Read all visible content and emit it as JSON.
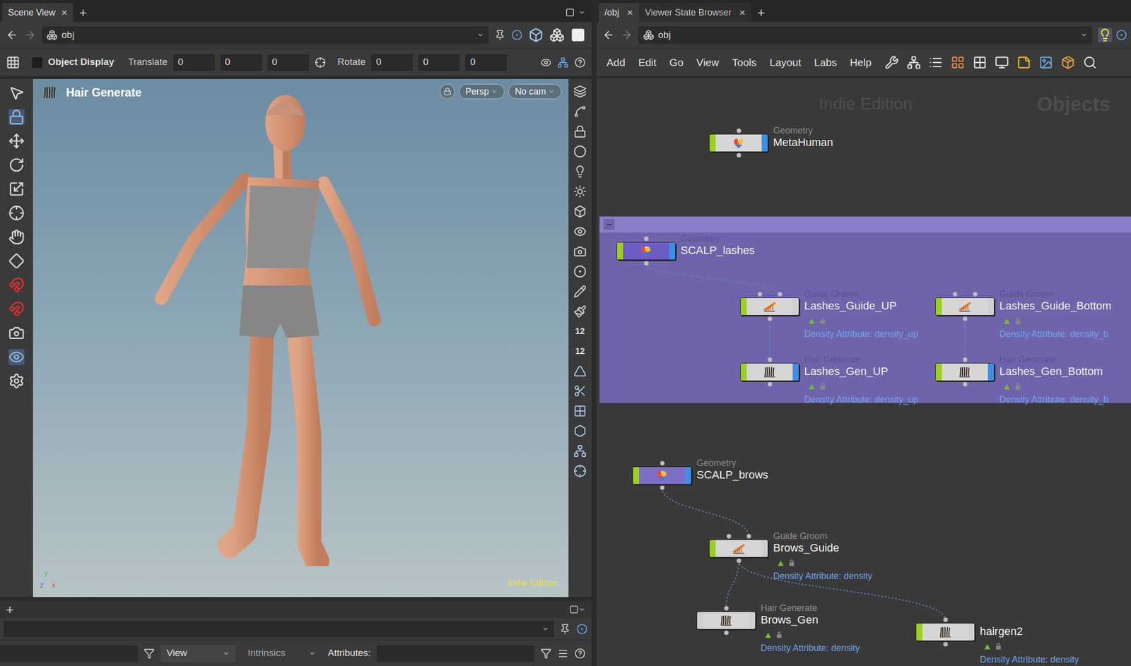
{
  "left_pane": {
    "tabs": [
      {
        "label": "Scene View",
        "selected": true
      }
    ],
    "close_glyph": "×",
    "add_glyph": "+",
    "path": "obj",
    "toolbar": {
      "object_display": {
        "label": "Object Display",
        "checked": false
      },
      "translate": {
        "label": "Translate",
        "values": [
          "0",
          "0",
          "0"
        ]
      },
      "rotate": {
        "label": "Rotate",
        "values": [
          "0",
          "0",
          "0"
        ]
      }
    },
    "viewport": {
      "title": "Hair Generate",
      "view": "Persp",
      "camera": "No cam",
      "watermark": "Indie Edition",
      "axes": [
        {
          "label": "y",
          "color": "#3cc63c"
        },
        {
          "label": "z",
          "color": "#4a6cff"
        },
        {
          "label": "x",
          "color": "#ff4040"
        }
      ]
    },
    "side_badges": [
      "12",
      "12"
    ],
    "bottom": {
      "add_glyph": "+",
      "view": "View",
      "intrinsics": "Intrinsics",
      "attributes_label": "Attributes:"
    }
  },
  "right_pane": {
    "tabs": [
      {
        "label": "/obj",
        "selected": true
      },
      {
        "label": "Viewer State Browser",
        "selected": false
      }
    ],
    "close_glyph": "×",
    "add_glyph": "+",
    "path": "obj",
    "menu": [
      "Add",
      "Edit",
      "Go",
      "View",
      "Tools",
      "Layout",
      "Labs",
      "Help"
    ],
    "watermarks": [
      "Indie Edition",
      "Objects"
    ],
    "network_box": {
      "collapse_glyph": "−"
    },
    "nodes": [
      {
        "kind": "geometry",
        "type_label": "Geometry",
        "name": "MetaHuman",
        "density": "",
        "color": "#d6d6d6",
        "left_flag": true,
        "display_flag": true,
        "in_box": false
      },
      {
        "kind": "geometry",
        "type_label": "Geometry",
        "name": "SCALP_lashes",
        "density": "",
        "color": "#6d5cc4",
        "left_flag": true,
        "display_flag": true,
        "in_box": true
      },
      {
        "kind": "guide",
        "type_label": "Guide Groom",
        "name": "Lashes_Guide_UP",
        "density": "Density Attribute: density_up",
        "color": "#d6d6d6",
        "left_flag": true,
        "display_flag": false,
        "in_box": true
      },
      {
        "kind": "guide",
        "type_label": "Guide Groom",
        "name": "Lashes_Guide_Bottom",
        "density": "Density Attribute: density_b",
        "color": "#d6d6d6",
        "left_flag": true,
        "display_flag": false,
        "in_box": true
      },
      {
        "kind": "hairgen",
        "type_label": "Hair Generate",
        "name": "Lashes_Gen_UP",
        "density": "Density Attribute: density_up",
        "color": "#d6d6d6",
        "left_flag": true,
        "display_flag": true,
        "in_box": true
      },
      {
        "kind": "hairgen",
        "type_label": "Hair Generate",
        "name": "Lashes_Gen_Bottom",
        "density": "Density Attribute: density_b",
        "color": "#d6d6d6",
        "left_flag": true,
        "display_flag": true,
        "in_box": true
      },
      {
        "kind": "geometry",
        "type_label": "Geometry",
        "name": "SCALP_brows",
        "density": "",
        "color": "#7d6ec6",
        "left_flag": true,
        "display_flag": true,
        "in_box": false
      },
      {
        "kind": "guide",
        "type_label": "Guide Groom",
        "name": "Brows_Guide",
        "density": "Density Attribute: density",
        "color": "#d6d6d6",
        "left_flag": true,
        "display_flag": false,
        "in_box": false
      },
      {
        "kind": "hairgen",
        "type_label": "Hair Generate",
        "name": "Brows_Gen",
        "density": "Density Attribute: density",
        "color": "#d6d6d6",
        "left_flag": false,
        "display_flag": false,
        "in_box": false
      },
      {
        "kind": "hairgen",
        "type_label": "",
        "name": "hairgen2",
        "density": "Density Attribute: density",
        "color": "#d6d6d6",
        "left_flag": true,
        "display_flag": false,
        "in_box": false
      }
    ],
    "wires": [
      [
        "SCALP_lashes",
        "Lashes_Guide_UP"
      ],
      [
        "Lashes_Guide_UP",
        "Lashes_Gen_UP"
      ],
      [
        "Lashes_Guide_Bottom",
        "Lashes_Gen_Bottom"
      ],
      [
        "SCALP_brows",
        "Brows_Guide"
      ],
      [
        "Brows_Guide",
        "Brows_Gen"
      ],
      [
        "Brows_Guide",
        "hairgen2"
      ]
    ]
  }
}
